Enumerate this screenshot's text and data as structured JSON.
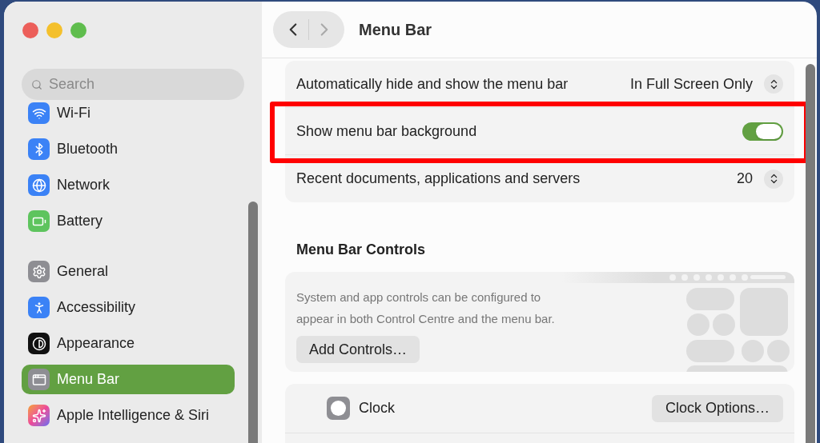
{
  "window": {
    "title": "Menu Bar"
  },
  "sidebar": {
    "search": {
      "placeholder": "Search"
    },
    "groups": [
      [
        {
          "label": "Wi-Fi",
          "kind": "wifi",
          "selected": false
        },
        {
          "label": "Bluetooth",
          "kind": "bluetooth",
          "selected": false
        },
        {
          "label": "Network",
          "kind": "network",
          "selected": false
        },
        {
          "label": "Battery",
          "kind": "battery",
          "selected": false
        }
      ],
      [
        {
          "label": "General",
          "kind": "general",
          "selected": false
        },
        {
          "label": "Accessibility",
          "kind": "accessibility",
          "selected": false
        },
        {
          "label": "Appearance",
          "kind": "appearance",
          "selected": false
        },
        {
          "label": "Menu Bar",
          "kind": "menubar",
          "selected": true
        },
        {
          "label": "Apple Intelligence & Siri",
          "kind": "siri",
          "selected": false
        }
      ]
    ]
  },
  "settings": {
    "rows": [
      {
        "kind": "popup",
        "label": "Automatically hide and show the menu bar",
        "value": "In Full Screen Only"
      },
      {
        "kind": "toggle",
        "label": "Show menu bar background",
        "on": true,
        "highlighted": true
      },
      {
        "kind": "stepper",
        "label": "Recent documents, applications and servers",
        "value": "20"
      }
    ]
  },
  "controls": {
    "heading": "Menu Bar Controls",
    "description": "System and app controls can be configured to appear in both Control Centre and the menu bar.",
    "button": "Add Controls…"
  },
  "items": [
    {
      "label": "Clock",
      "button": "Clock Options…"
    }
  ]
}
